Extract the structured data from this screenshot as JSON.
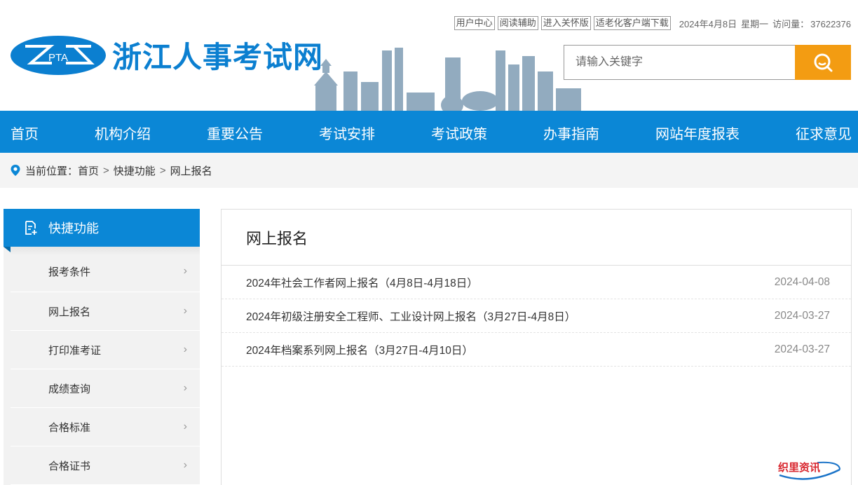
{
  "header": {
    "site_title": "浙江人事考试网",
    "logo_text": "PTA",
    "toplinks": [
      "用户中心",
      "阅读辅助",
      "进入关怀版",
      "适老化客户端下载"
    ],
    "date": "2024年4月8日",
    "weekday": "星期一",
    "visits_label": "访问量：",
    "visits_value": "37622376",
    "search_placeholder": "请输入关键字"
  },
  "nav": [
    "首页",
    "机构介绍",
    "重要公告",
    "考试安排",
    "考试政策",
    "办事指南",
    "网站年度报表",
    "征求意见"
  ],
  "breadcrumb": {
    "label": "当前位置：",
    "items": [
      "首页",
      "快捷功能",
      "网上报名"
    ],
    "separator": ">"
  },
  "sidebar": {
    "title": "快捷功能",
    "items": [
      "报考条件",
      "网上报名",
      "打印准考证",
      "成绩查询",
      "合格标准",
      "合格证书"
    ]
  },
  "content": {
    "title": "网上报名",
    "rows": [
      {
        "title": "2024年社会工作者网上报名（4月8日-4月18日）",
        "date": "2024-04-08"
      },
      {
        "title": "2024年初级注册安全工程师、工业设计网上报名（3月27日-4月8日）",
        "date": "2024-03-27"
      },
      {
        "title": "2024年档案系列网上报名（3月27日-4月10日）",
        "date": "2024-03-27"
      }
    ]
  },
  "watermark_text": "织里资讯",
  "colors": {
    "primary": "#0b87d6",
    "accent": "#f39c12"
  }
}
